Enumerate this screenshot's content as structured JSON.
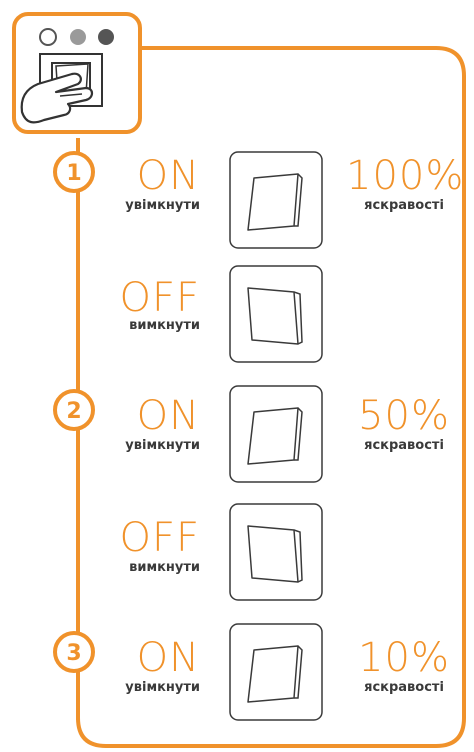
{
  "colors": {
    "accent": "#F0922B",
    "line": "#3a3a3a",
    "dot_light": "#ffffff",
    "dot_mid": "#9a9a9a",
    "dot_dark": "#555555"
  },
  "icons": {
    "header": "hand-pressing-switch-icon",
    "switch": "rocker-switch-icon"
  },
  "steps": [
    {
      "number": "1",
      "on_label": "ON",
      "on_sub": "увімкнути",
      "brightness": "100%",
      "brightness_sub": "яскравості",
      "off_label": "OFF",
      "off_sub": "вимкнути"
    },
    {
      "number": "2",
      "on_label": "ON",
      "on_sub": "увімкнути",
      "brightness": "50%",
      "brightness_sub": "яскравості",
      "off_label": "OFF",
      "off_sub": "вимкнути"
    },
    {
      "number": "3",
      "on_label": "ON",
      "on_sub": "увімкнути",
      "brightness": "10%",
      "brightness_sub": "яскравості"
    }
  ]
}
